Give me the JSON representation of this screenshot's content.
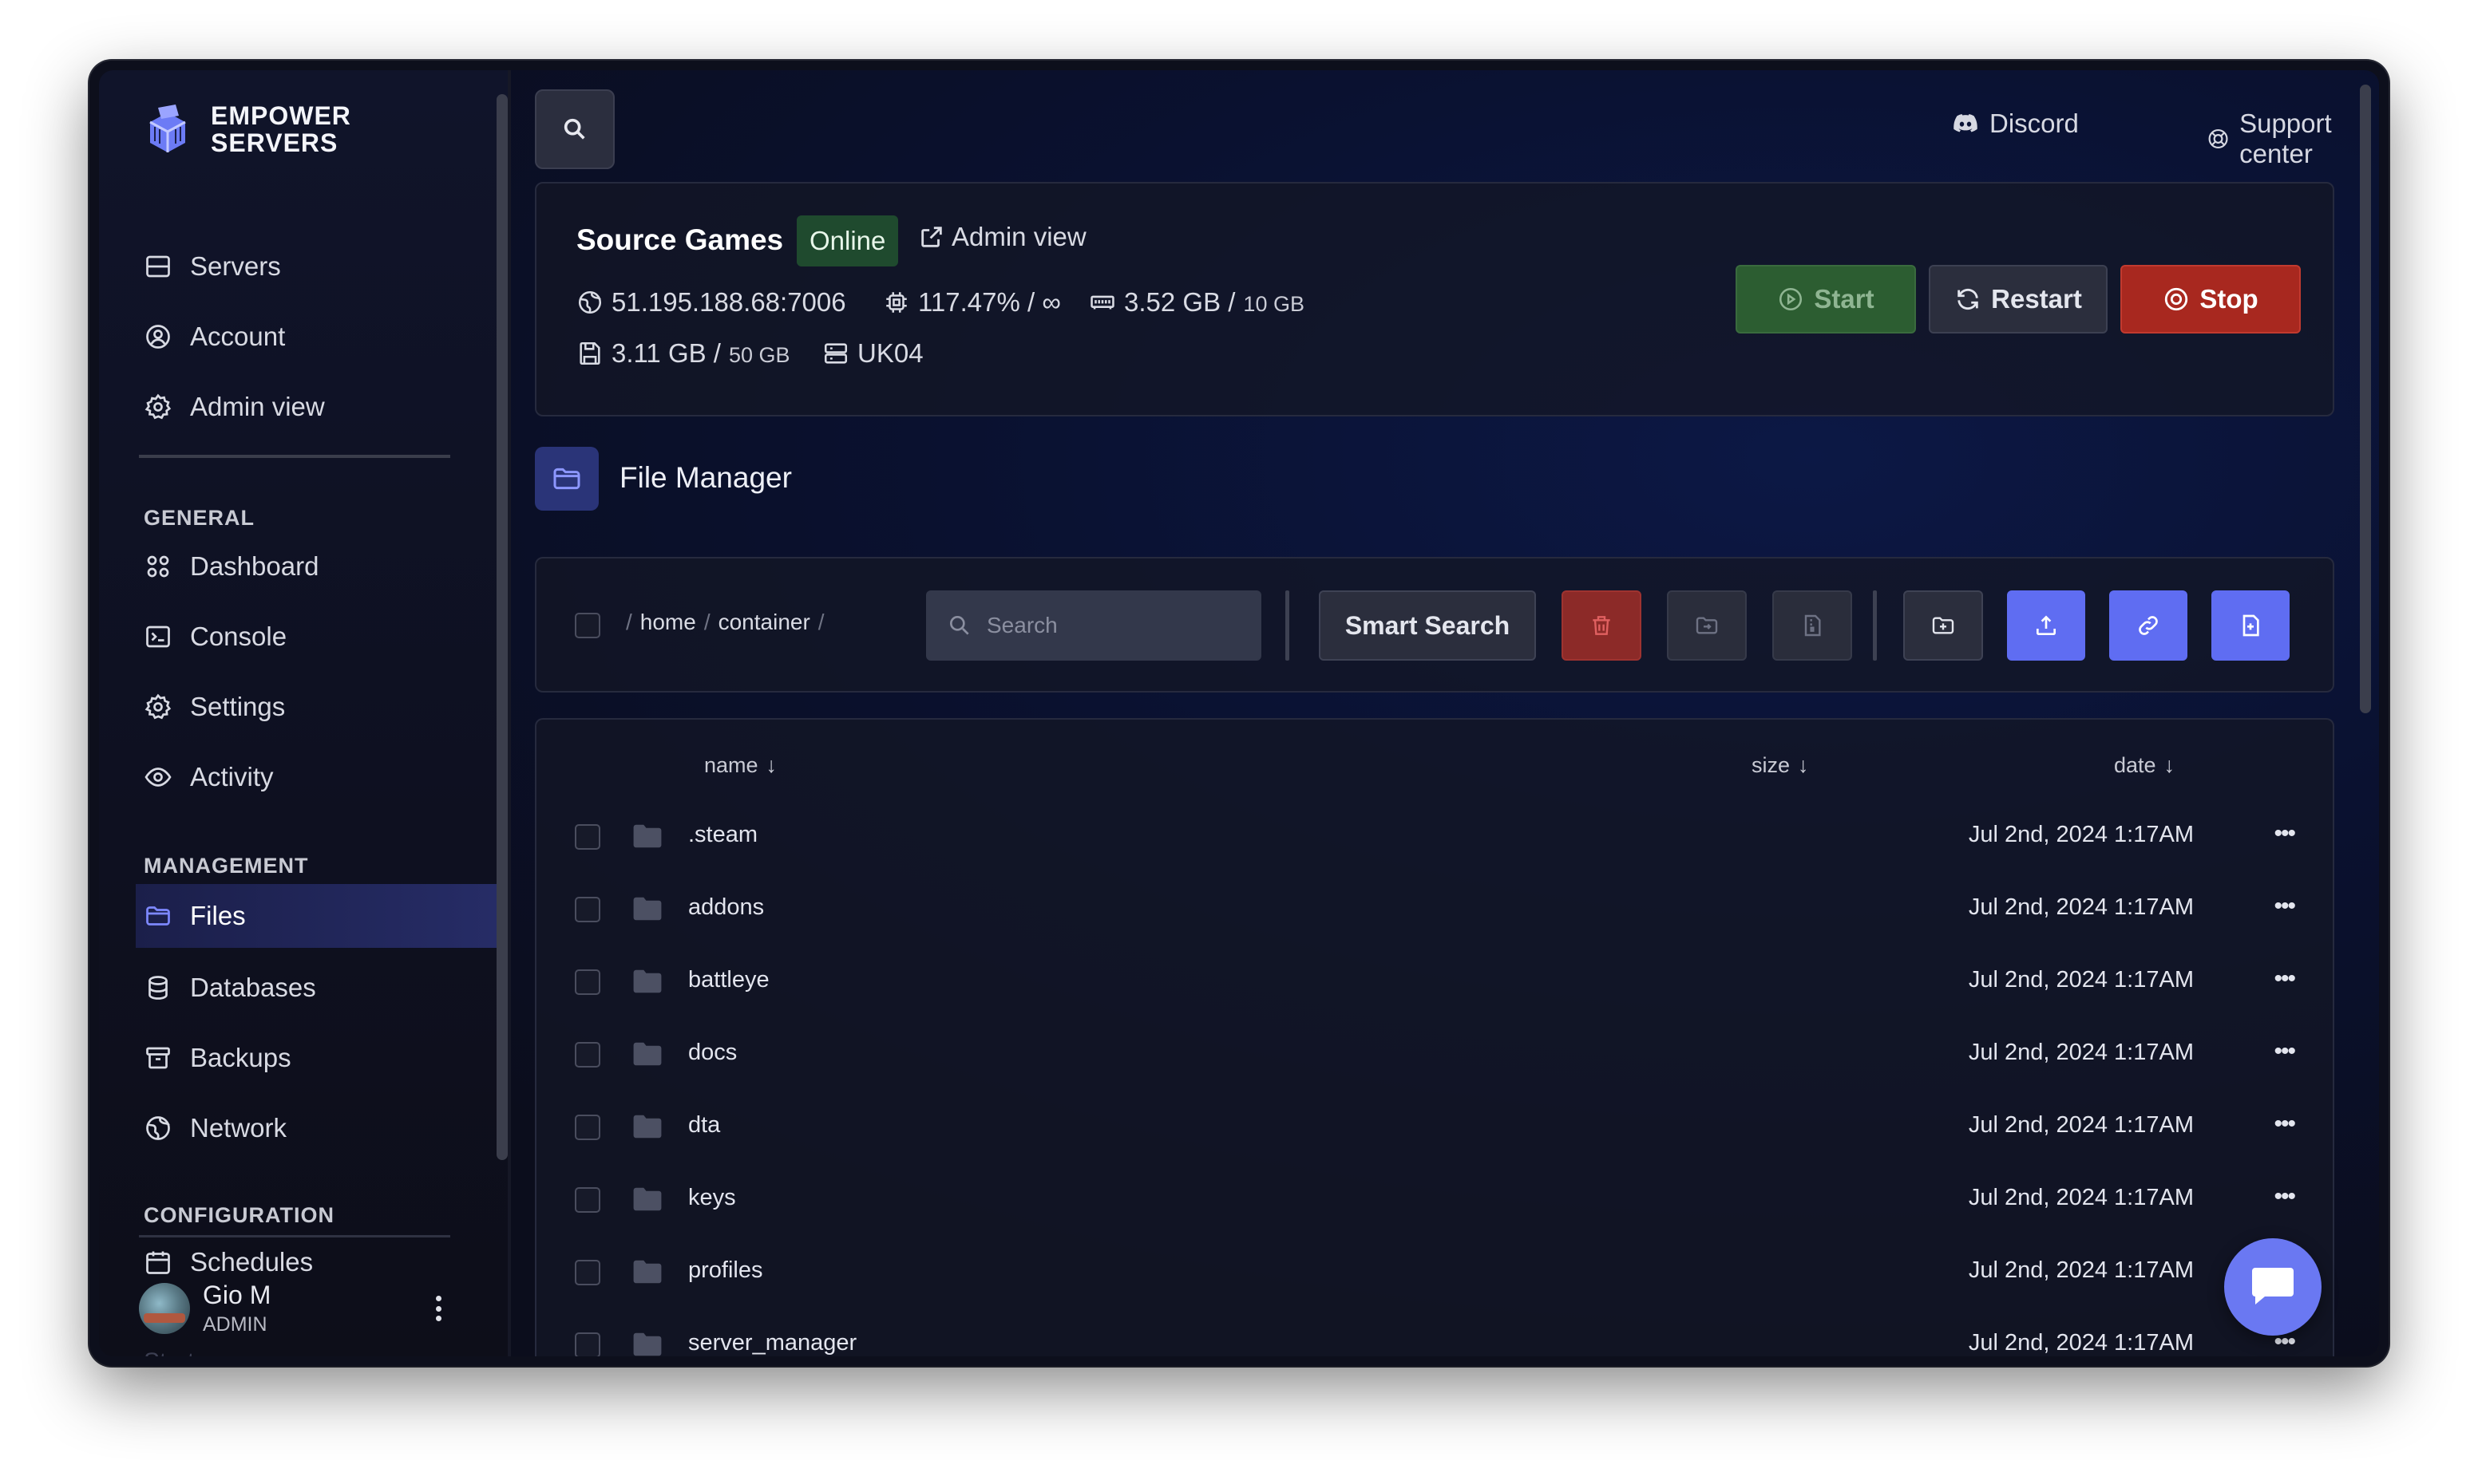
{
  "brand": {
    "name_line1": "EMPOWER",
    "name_line2": "SERVERS"
  },
  "sidebar": {
    "top_items": [
      {
        "label": "Servers",
        "icon": "server-icon"
      },
      {
        "label": "Account",
        "icon": "user-circle-icon"
      },
      {
        "label": "Admin view",
        "icon": "gear-icon"
      }
    ],
    "sections": {
      "general": "GENERAL",
      "management": "MANAGEMENT",
      "configuration": "CONFIGURATION"
    },
    "general_items": [
      {
        "label": "Dashboard",
        "icon": "grid-icon"
      },
      {
        "label": "Console",
        "icon": "terminal-icon"
      },
      {
        "label": "Settings",
        "icon": "gear-icon"
      },
      {
        "label": "Activity",
        "icon": "eye-icon"
      }
    ],
    "management_items": [
      {
        "label": "Files",
        "icon": "folder-icon",
        "active": true
      },
      {
        "label": "Databases",
        "icon": "database-icon"
      },
      {
        "label": "Backups",
        "icon": "archive-icon"
      },
      {
        "label": "Network",
        "icon": "globe-icon"
      }
    ],
    "configuration_items": [
      {
        "label": "Schedules",
        "icon": "calendar-icon"
      }
    ],
    "ghost_item": "Startup",
    "user": {
      "name": "Gio M",
      "role": "ADMIN"
    }
  },
  "topbar": {
    "discord_label": "Discord",
    "support_label": "Support center"
  },
  "server": {
    "name": "Source Games",
    "status": "Online",
    "admin_view_label": "Admin view",
    "address": "51.195.188.68:7006",
    "cpu": "117.47% / ∞",
    "memory_used": "3.52 GB /",
    "memory_limit": "10 GB",
    "disk_used": "3.11 GB /",
    "disk_limit": "50 GB",
    "node": "UK04",
    "buttons": {
      "start": "Start",
      "restart": "Restart",
      "stop": "Stop"
    },
    "colors": {
      "start": "#2c5d31",
      "restart": "#2b2e3d",
      "stop": "#a8281f",
      "online": "#1f4a2e"
    }
  },
  "file_manager": {
    "title": "File Manager",
    "breadcrumb": {
      "sep": "/",
      "home": "home",
      "container": "container"
    },
    "search_placeholder": "Search",
    "smart_search_label": "Smart Search",
    "columns": {
      "name": "name",
      "size": "size",
      "date": "date",
      "sort_indicator": "↓"
    },
    "rows": [
      {
        "name": ".steam",
        "date": "Jul 2nd, 2024 1:17AM"
      },
      {
        "name": "addons",
        "date": "Jul 2nd, 2024 1:17AM"
      },
      {
        "name": "battleye",
        "date": "Jul 2nd, 2024 1:17AM"
      },
      {
        "name": "docs",
        "date": "Jul 2nd, 2024 1:17AM"
      },
      {
        "name": "dta",
        "date": "Jul 2nd, 2024 1:17AM"
      },
      {
        "name": "keys",
        "date": "Jul 2nd, 2024 1:17AM"
      },
      {
        "name": "profiles",
        "date": "Jul 2nd, 2024 1:17AM"
      },
      {
        "name": "server_manager",
        "date": "Jul 2nd, 2024 1:17AM"
      }
    ],
    "row_menu": "•••",
    "accent": "#5f6df2"
  }
}
